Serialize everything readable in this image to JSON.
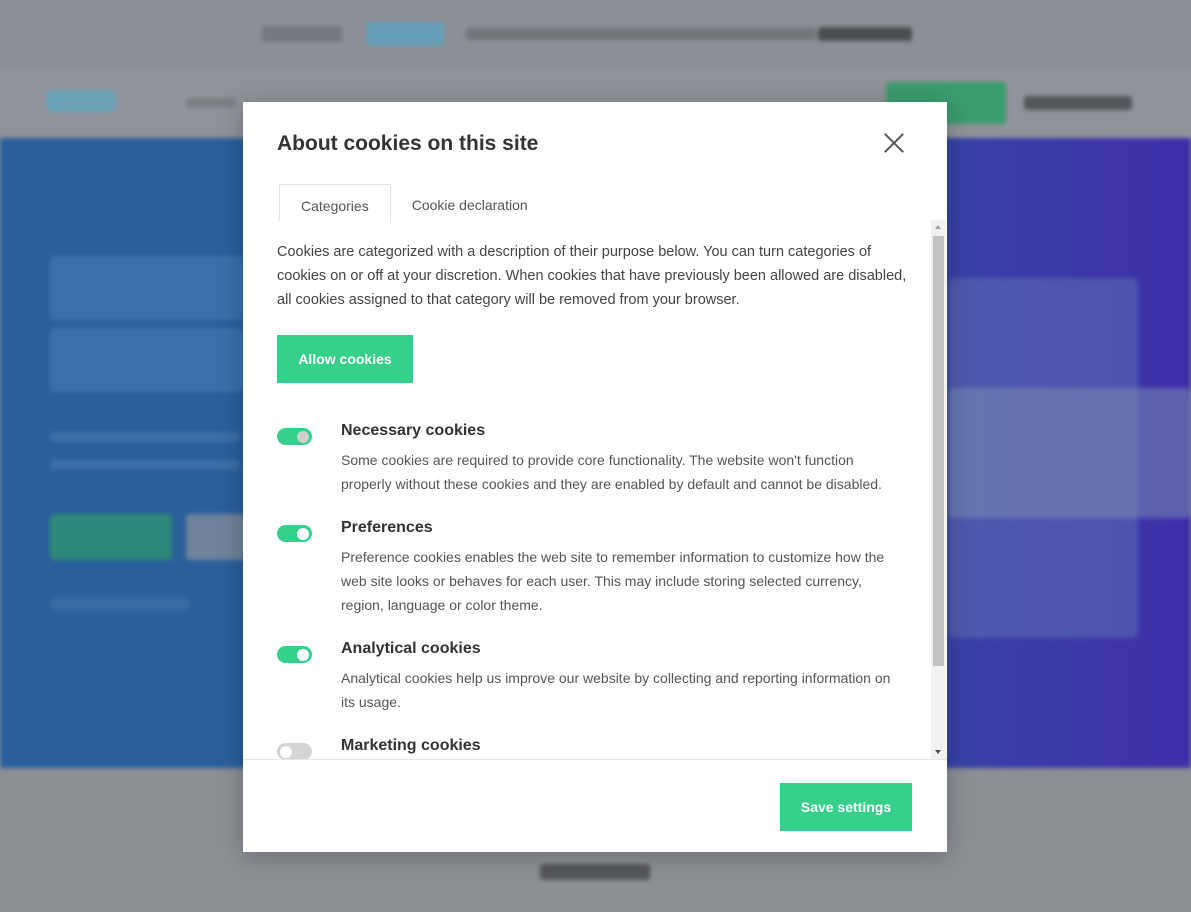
{
  "modal": {
    "title": "About cookies on this site",
    "tabs": [
      {
        "label": "Categories",
        "active": true
      },
      {
        "label": "Cookie declaration",
        "active": false
      }
    ],
    "intro": "Cookies are categorized with a description of their purpose below. You can turn categories of cookies on or off at your discretion. When cookies that have previously been allowed are disabled, all cookies assigned to that category will be removed from your browser.",
    "allow_label": "Allow cookies",
    "categories": [
      {
        "title": "Necessary cookies",
        "description": "Some cookies are required to provide core functionality. The website won't function properly without these cookies and they are enabled by default and cannot be disabled.",
        "enabled": true,
        "locked": true
      },
      {
        "title": "Preferences",
        "description": "Preference cookies enables the web site to remember information to customize how the web site looks or behaves for each user. This may include storing selected currency, region, language or color theme.",
        "enabled": true,
        "locked": false
      },
      {
        "title": "Analytical cookies",
        "description": "Analytical cookies help us improve our website by collecting and reporting information on its usage.",
        "enabled": true,
        "locked": false
      },
      {
        "title": "Marketing cookies",
        "description": "",
        "enabled": false,
        "locked": false
      }
    ],
    "save_label": "Save settings"
  },
  "colors": {
    "accent": "#36cf8c",
    "overlay": "#8d9096",
    "hero_start": "#2a5f9c",
    "hero_end": "#3f2fa9"
  },
  "icons": {
    "close": "close-icon",
    "scroll_up": "arrow-up-icon",
    "scroll_down": "arrow-down-icon"
  }
}
